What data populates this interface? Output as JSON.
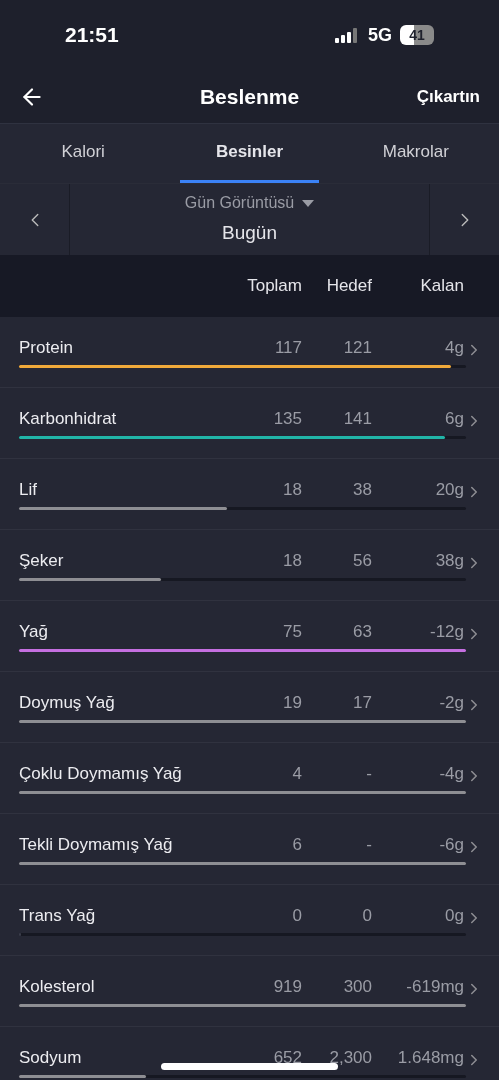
{
  "status_bar": {
    "time": "21:51",
    "network": "5G",
    "battery": "41"
  },
  "header": {
    "title": "Beslenme",
    "action": "Çıkartın"
  },
  "tabs": [
    {
      "label": "Kalori",
      "selected": false
    },
    {
      "label": "Besinler",
      "selected": true
    },
    {
      "label": "Makrolar",
      "selected": false
    }
  ],
  "date_nav": {
    "view": "Gün Görüntüsü",
    "date": "Bugün"
  },
  "table": {
    "columns": [
      "Toplam",
      "Hedef",
      "Kalan"
    ],
    "rows": [
      {
        "name": "Protein",
        "total": "117",
        "target": "121",
        "remaining": "4g",
        "level": 0.966,
        "color": "#f0a93a"
      },
      {
        "name": "Karbonhidrat",
        "total": "135",
        "target": "141",
        "remaining": "6g",
        "level": 0.953,
        "color": "#21b5a8"
      },
      {
        "name": "Lif",
        "total": "18",
        "target": "38",
        "remaining": "20g",
        "level": 0.465,
        "color": "#8e8e93"
      },
      {
        "name": "Şeker",
        "total": "18",
        "target": "56",
        "remaining": "38g",
        "level": 0.318,
        "color": "#8e8e93"
      },
      {
        "name": "Yağ",
        "total": "75",
        "target": "63",
        "remaining": "-12g",
        "level": 1,
        "color": "#c56fe0"
      },
      {
        "name": "Doymuş Yağ",
        "total": "19",
        "target": "17",
        "remaining": "-2g",
        "level": 1,
        "color": "#8e8e93"
      },
      {
        "name": "Çoklu Doymamış Yağ",
        "total": "4",
        "target": "-",
        "remaining": "-4g",
        "level": 1,
        "color": "#8e8e93"
      },
      {
        "name": "Tekli Doymamış Yağ",
        "total": "6",
        "target": "-",
        "remaining": "-6g",
        "level": 1,
        "color": "#8e8e93"
      },
      {
        "name": "Trans Yağ",
        "total": "0",
        "target": "0",
        "remaining": "0g",
        "level": 0
      },
      {
        "name": "Kolesterol",
        "total": "919",
        "target": "300",
        "remaining": "-619mg",
        "level": 1,
        "color": "#8e8e93"
      },
      {
        "name": "Sodyum",
        "total": "652",
        "target": "2,300",
        "remaining": "1.648mg",
        "level": 0.284,
        "color": "#8e8e93"
      }
    ]
  }
}
